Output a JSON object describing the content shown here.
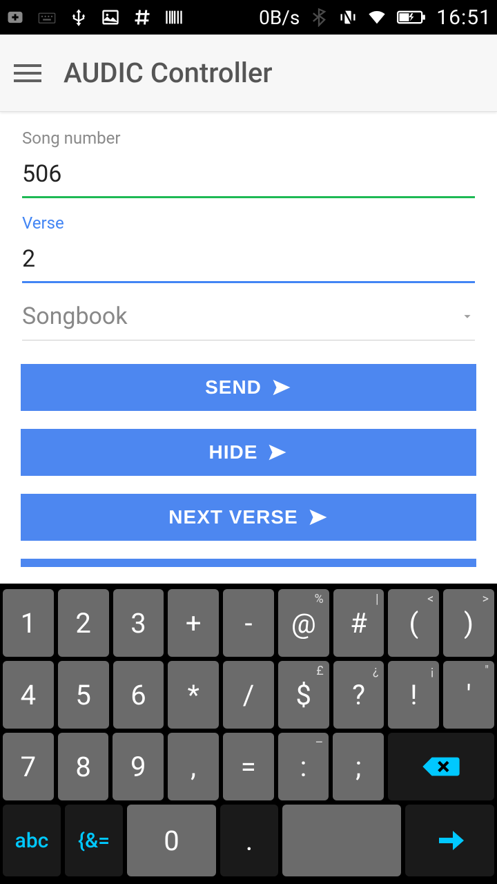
{
  "status": {
    "data_rate": "0B/s",
    "time": "16:51"
  },
  "appbar": {
    "title": "AUDIC Controller"
  },
  "fields": {
    "song_label": "Song number",
    "song_value": "506",
    "verse_label": "Verse",
    "verse_value": "2",
    "songbook_placeholder": "Songbook"
  },
  "buttons": {
    "send": "SEND",
    "hide": "HIDE",
    "next_verse": "NEXT VERSE"
  },
  "keyboard": {
    "row1": [
      {
        "main": "1",
        "alt": ""
      },
      {
        "main": "2",
        "alt": ""
      },
      {
        "main": "3",
        "alt": ""
      },
      {
        "main": "+",
        "alt": ""
      },
      {
        "main": "-",
        "alt": ""
      },
      {
        "main": "@",
        "alt": "%"
      },
      {
        "main": "#",
        "alt": "|"
      },
      {
        "main": "(",
        "alt": "<"
      },
      {
        "main": ")",
        "alt": ">"
      }
    ],
    "row2": [
      {
        "main": "4",
        "alt": ""
      },
      {
        "main": "5",
        "alt": ""
      },
      {
        "main": "6",
        "alt": ""
      },
      {
        "main": "*",
        "alt": ""
      },
      {
        "main": "/",
        "alt": ""
      },
      {
        "main": "$",
        "alt": "£"
      },
      {
        "main": "?",
        "alt": "¿"
      },
      {
        "main": "!",
        "alt": "¡"
      },
      {
        "main": "'",
        "alt": "\""
      }
    ],
    "row3": [
      {
        "main": "7",
        "alt": ""
      },
      {
        "main": "8",
        "alt": ""
      },
      {
        "main": "9",
        "alt": ""
      },
      {
        "main": ",",
        "alt": ""
      },
      {
        "main": "=",
        "alt": ""
      },
      {
        "main": ":",
        "alt": "–"
      },
      {
        "main": ";",
        "alt": ""
      }
    ],
    "row4": {
      "abc": "abc",
      "sym": "{&=",
      "zero": "0",
      "dot": "."
    }
  }
}
